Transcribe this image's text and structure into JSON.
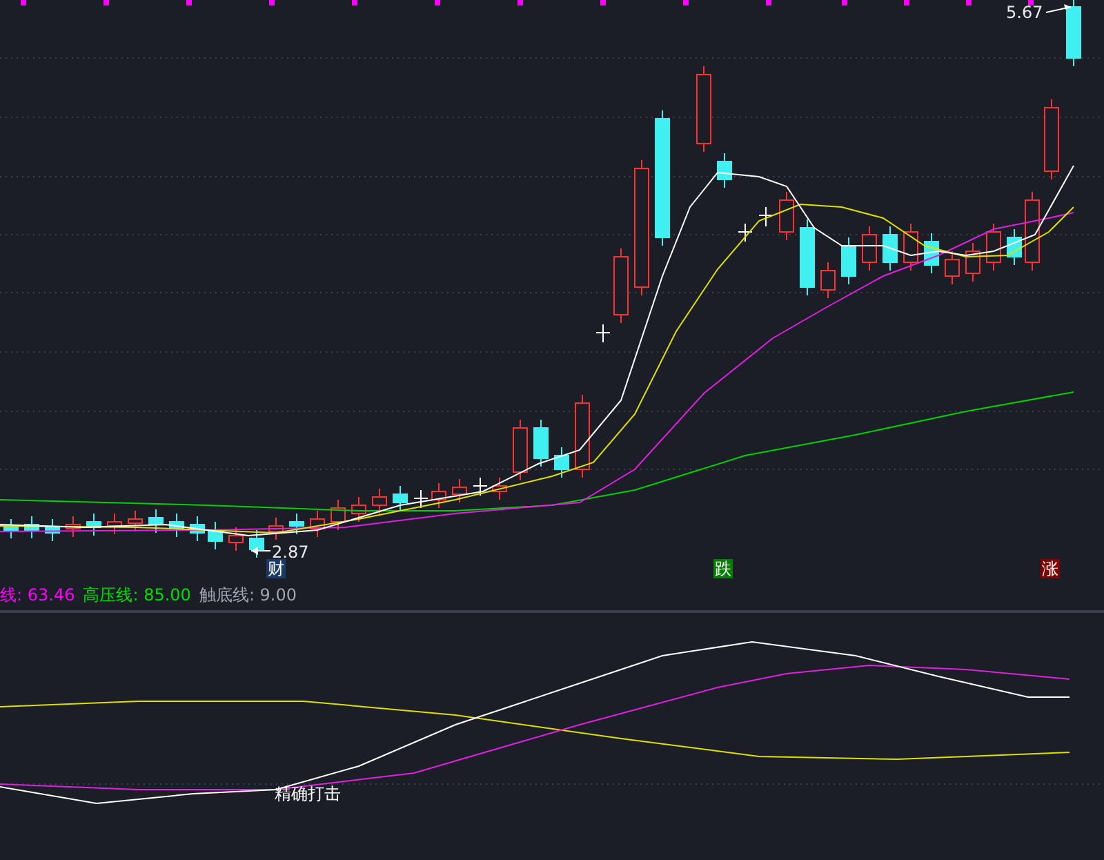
{
  "price_chart": {
    "labels": [
      {
        "kind": "high",
        "text": "5.67"
      },
      {
        "kind": "low",
        "text": "2.87"
      }
    ],
    "signals": [
      {
        "kind": "wealth",
        "text": "财"
      },
      {
        "kind": "fall",
        "text": "跌"
      },
      {
        "kind": "rise",
        "text": "涨"
      }
    ]
  },
  "indicator": {
    "legend": [
      {
        "text": "线: 63.46",
        "color": "#ff00ff"
      },
      {
        "text": "高压线: 85.00",
        "color": "#00e000"
      },
      {
        "text": "触底线: 9.00",
        "color": "#a0a4b0"
      }
    ],
    "signal_text": "精确打击"
  }
}
